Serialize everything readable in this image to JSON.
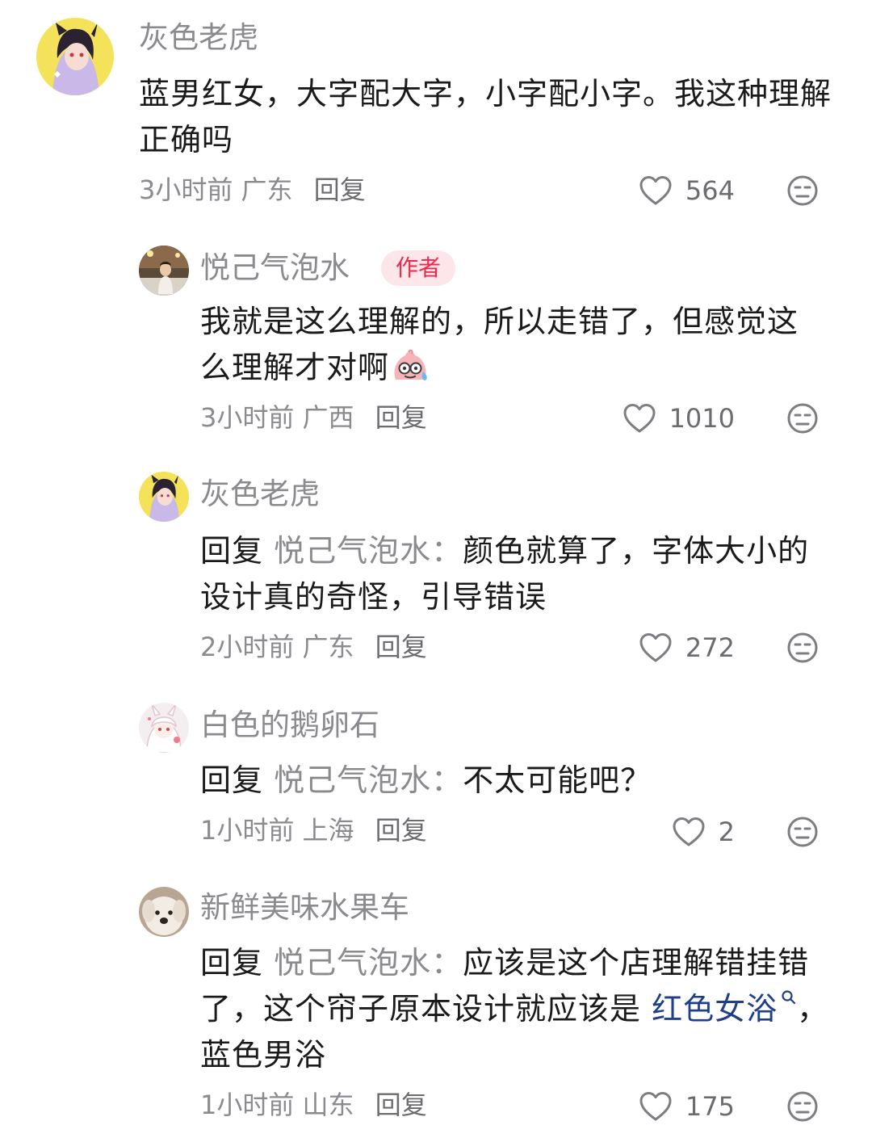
{
  "comments": [
    {
      "username": "灰色老虎",
      "text": "蓝男红女，大字配大字，小字配小字。我这种理解正确吗",
      "time": "3小时前",
      "location": "广东",
      "reply_label": "回复",
      "likes": "564"
    },
    {
      "username": "悦己气泡水",
      "badge": "作者",
      "text": "我就是这么理解的，所以走错了，但感觉这么理解才对啊",
      "emoji_icon": "sweating-face-emoji",
      "time": "3小时前",
      "location": "广西",
      "reply_label": "回复",
      "likes": "1010"
    },
    {
      "username": "灰色老虎",
      "reply_prefix": "回复",
      "reply_target": "悦己气泡水：",
      "text": "颜色就算了，字体大小的设计真的奇怪，引导错误",
      "time": "2小时前",
      "location": "广东",
      "reply_label": "回复",
      "likes": "272"
    },
    {
      "username": "白色的鹅卵石",
      "reply_prefix": "回复",
      "reply_target": "悦己气泡水：",
      "text": "不太可能吧？",
      "time": "1小时前",
      "location": "上海",
      "reply_label": "回复",
      "likes": "2"
    },
    {
      "username": "新鲜美味水果车",
      "reply_prefix": "回复",
      "reply_target": "悦己气泡水：",
      "text_before_link": "应该是这个店理解错挂错了，这个帘子原本设计就应该是 ",
      "link_text": "红色女浴",
      "text_after_link": "，蓝色男浴",
      "time": "1小时前",
      "location": "山东",
      "reply_label": "回复",
      "likes": "175"
    }
  ],
  "colors": {
    "text_primary": "#1a1a1a",
    "text_secondary": "#8a8a8f",
    "author_badge_bg": "#fde6e9",
    "author_badge_text": "#f0284a",
    "link": "#1f3f8a"
  },
  "icons": {
    "like": "heart-outline-icon",
    "dislike": "neutral-face-icon",
    "search": "search-icon"
  }
}
